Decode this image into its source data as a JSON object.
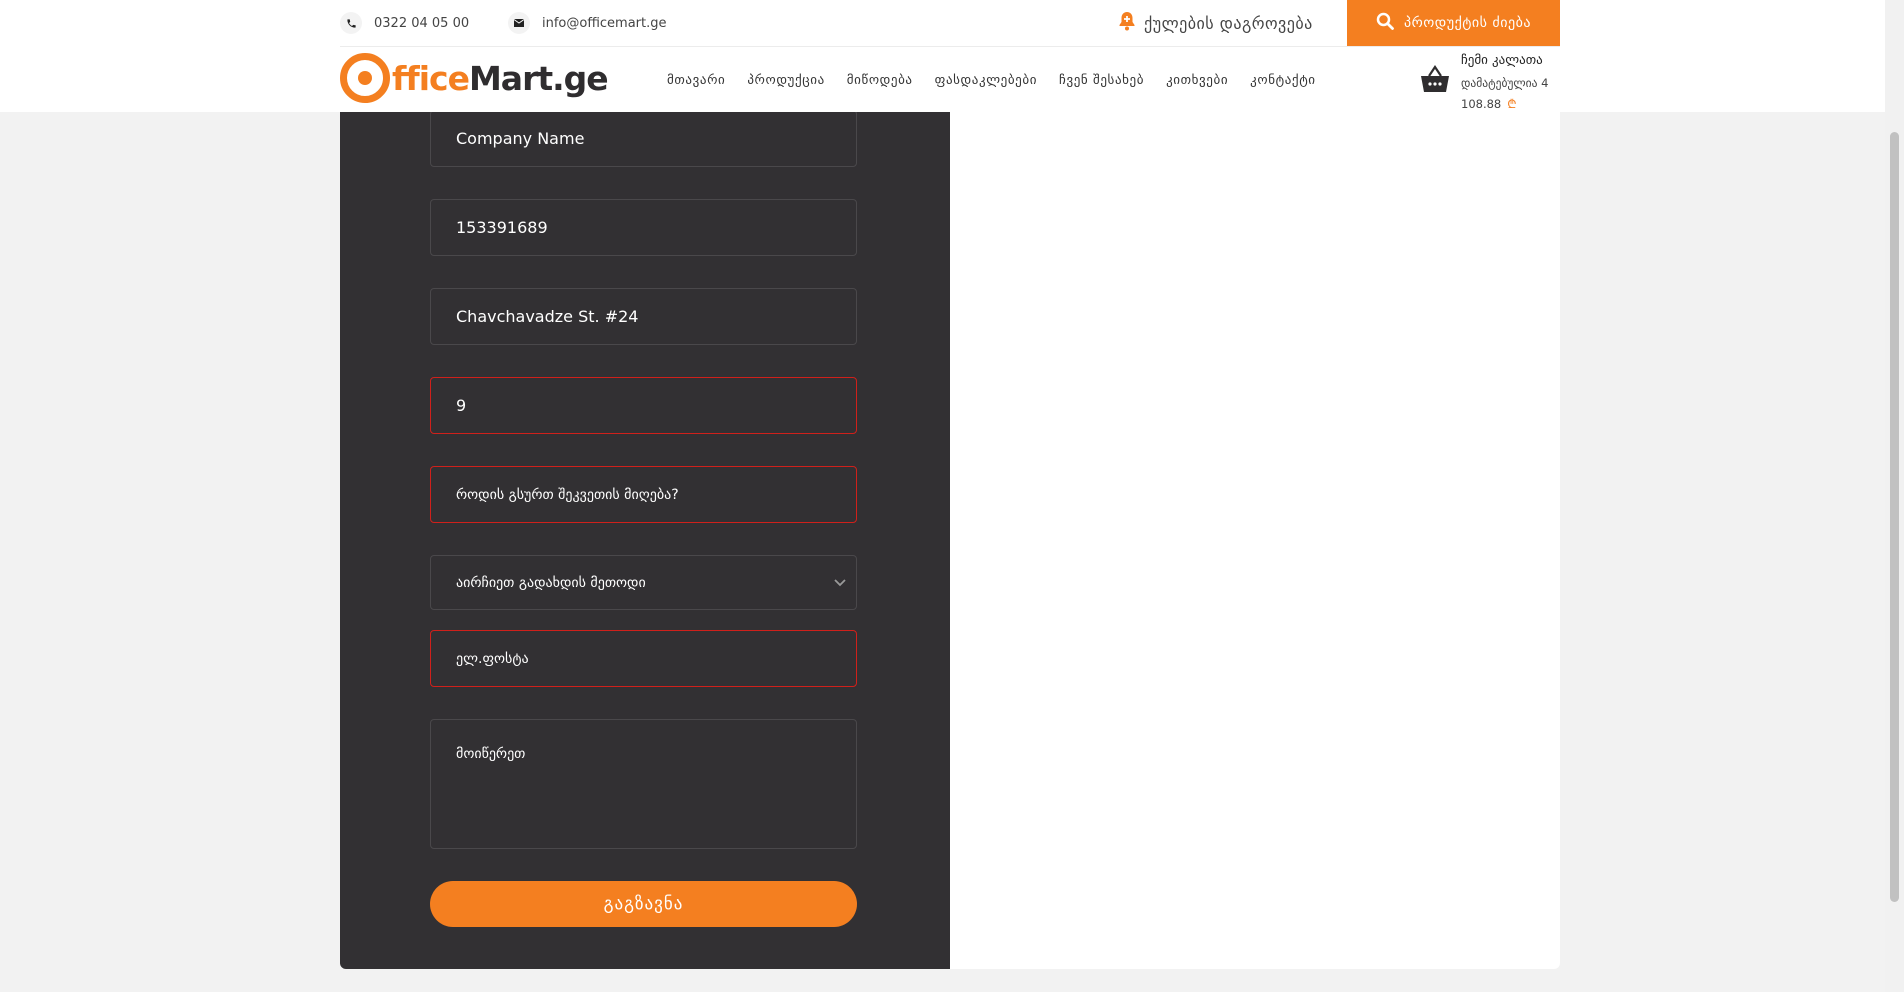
{
  "header": {
    "phone": "0322 04 05 00",
    "email": "info@officemart.ge",
    "notify_label": "ქულების დაგროვება",
    "search_label": "პროდუქტის ძიება",
    "logo": {
      "part1": "ffice",
      "part2": "Mart.ge"
    },
    "nav": [
      "მთავარი",
      "პროდუქცია",
      "მიწოდება",
      "ფასდაკლებები",
      "ჩვენ შესახებ",
      "კითხვები",
      "კონტაქტი"
    ],
    "cart": {
      "title": "ჩემი კალათა",
      "added": "დამატებულია 4",
      "total": "108.88",
      "currency": "₾"
    }
  },
  "form": {
    "company_name": "Company Name",
    "id_number": "153391689",
    "address": "Chavchavadze St. #24",
    "phone_value": "9",
    "delivery_time_placeholder": "როდის გსურთ შეკვეთის მიღება?",
    "payment_select": "აირჩიეთ გადახდის მეთოდი",
    "email_placeholder": "ელ.ფოსტა",
    "comment_placeholder": "მოიწერეთ",
    "submit_label": "გაგზავნა"
  },
  "colors": {
    "accent": "#f47f20",
    "dark_panel": "#323033",
    "error": "#d0201b"
  }
}
